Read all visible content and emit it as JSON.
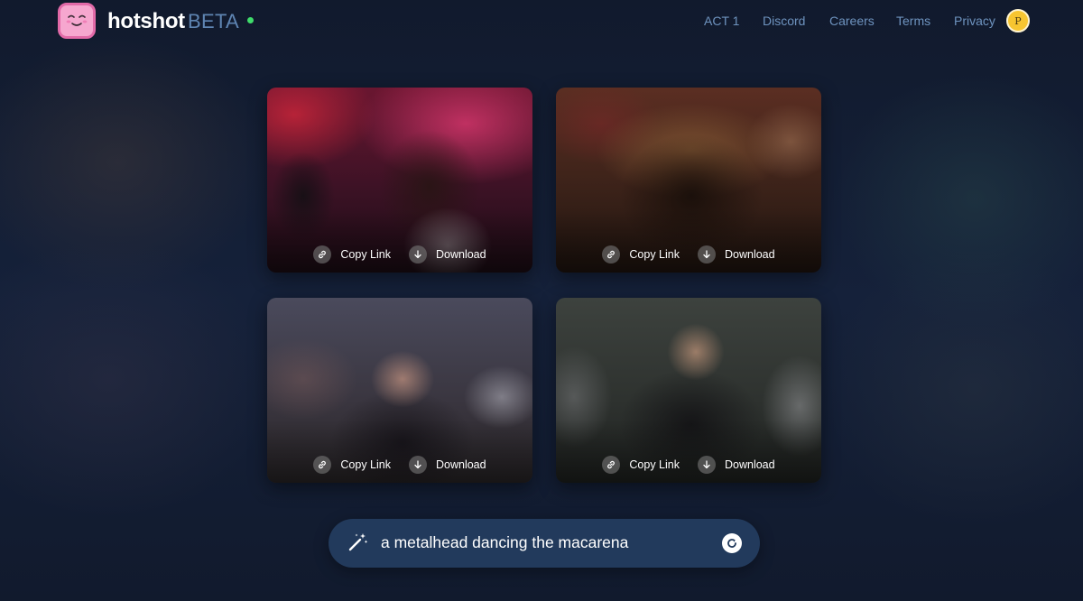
{
  "header": {
    "logo": {
      "icon": "smiley-tv-icon",
      "color": "#f6a7cf"
    },
    "brand_name": "hotshot",
    "beta_label": "BETA",
    "status_color": "#3fdc6b",
    "nav": [
      {
        "label": "ACT 1"
      },
      {
        "label": "Discord"
      },
      {
        "label": "Careers"
      },
      {
        "label": "Terms"
      },
      {
        "label": "Privacy"
      }
    ],
    "avatar_initial": "P"
  },
  "videos": [
    {
      "copy_link_label": "Copy Link",
      "download_label": "Download"
    },
    {
      "copy_link_label": "Copy Link",
      "download_label": "Download"
    },
    {
      "copy_link_label": "Copy Link",
      "download_label": "Download"
    },
    {
      "copy_link_label": "Copy Link",
      "download_label": "Download"
    }
  ],
  "prompt": {
    "text": "a metalhead dancing the macarena",
    "wand_icon": "magic-wand-icon",
    "regenerate_icon": "regenerate-icon"
  }
}
